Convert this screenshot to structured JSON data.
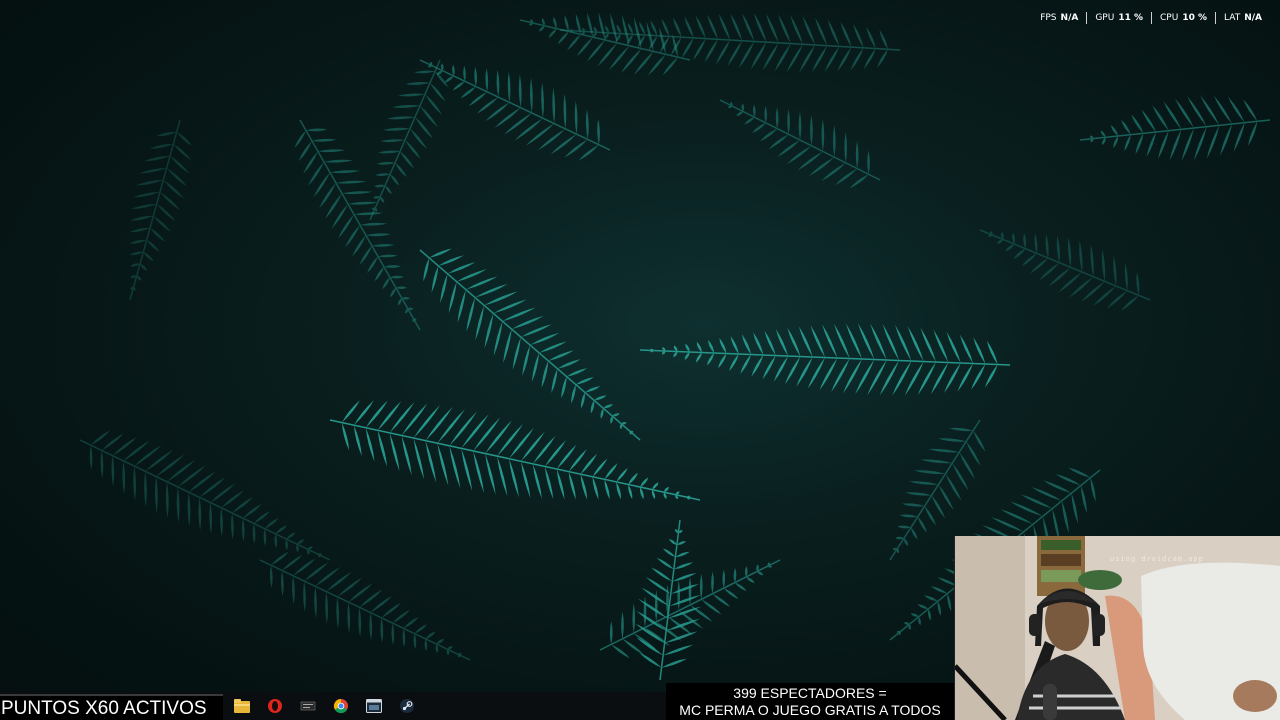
{
  "wallpaper": {
    "subject": "teal fern leaves on dark background",
    "accent": "#2fb7a8",
    "background": "#081818"
  },
  "perf_overlay": {
    "items": [
      {
        "label": "FPS",
        "value": "N/A"
      },
      {
        "label": "GPU",
        "value": "11 %"
      },
      {
        "label": "CPU",
        "value": "10 %"
      },
      {
        "label": "LAT",
        "value": "N/A"
      }
    ]
  },
  "stream_overlay": {
    "points_banner": "PUNTOS X60 ACTIVOS",
    "viewer_line1": "399 ESPECTADORES =",
    "viewer_line2": "MC PERMA O JUEGO GRATIS A TODOS"
  },
  "webcam": {
    "watermark": "using droidcam.app"
  },
  "taskbar": {
    "icons": [
      "file-explorer-icon",
      "opera-icon",
      "app-icon",
      "chrome-icon",
      "window-app-icon",
      "steam-icon"
    ]
  }
}
